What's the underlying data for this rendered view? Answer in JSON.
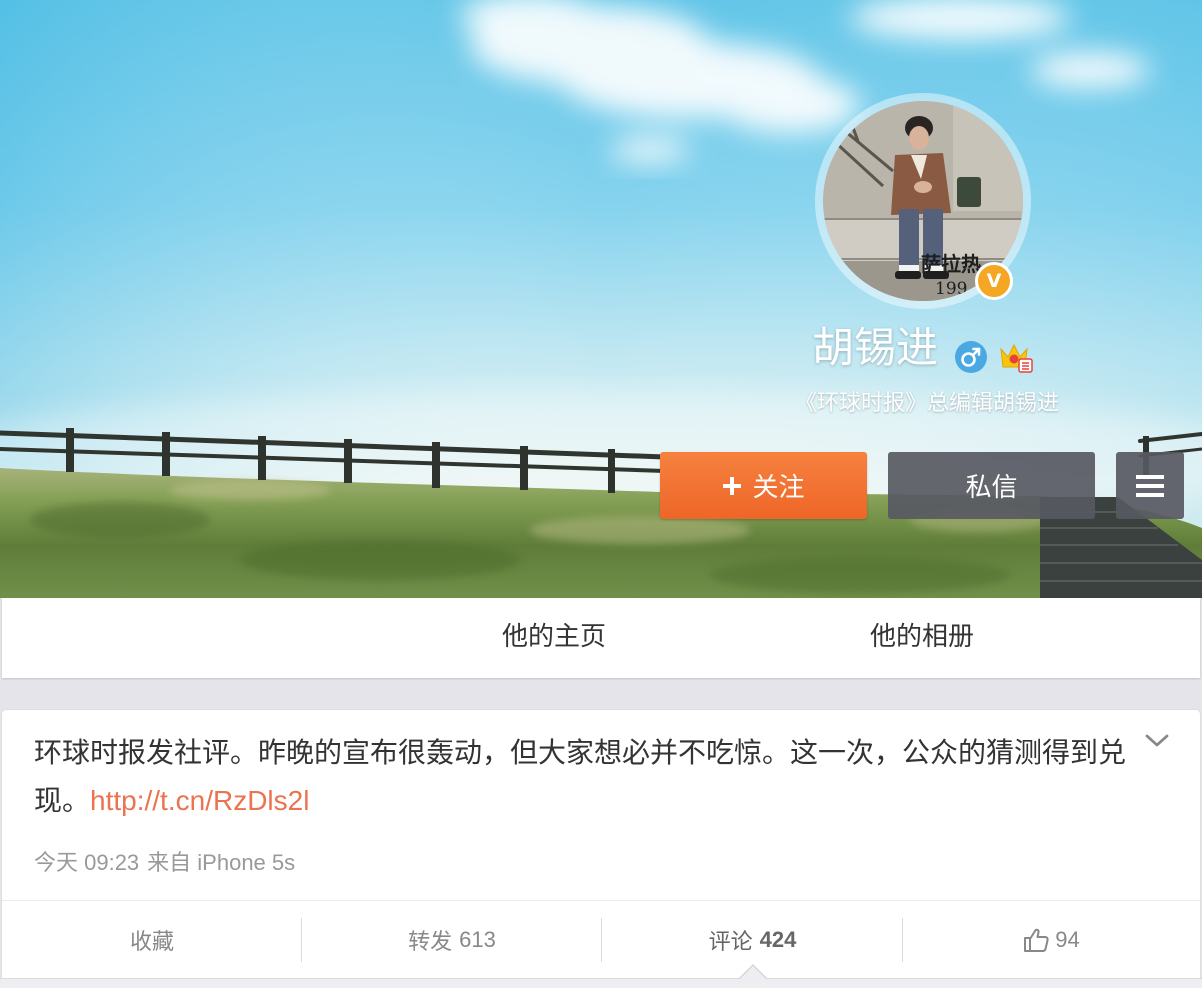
{
  "cover": {
    "image_icon": "landscape-cover"
  },
  "profile": {
    "avatar": {
      "caption_line1": "萨拉热",
      "caption_line2": "199"
    },
    "verified_badge": "V",
    "name": "胡锡进",
    "gender_icon": "male-icon",
    "member_icon": "crown-icon",
    "description": "《环球时报》总编辑胡锡进"
  },
  "actions": {
    "follow": {
      "icon": "plus-icon",
      "label": "关注"
    },
    "message": {
      "label": "私信"
    },
    "menu": {
      "icon": "menu-icon"
    }
  },
  "tabs": [
    {
      "label": "他的主页"
    },
    {
      "label": "他的相册"
    }
  ],
  "post": {
    "text": "环球时报发社评。昨晚的宣布很轰动，但大家想必并不吃惊。这一次，公众的猜测得到兑现。",
    "link": "http://t.cn/RzDls2l",
    "time": "今天 09:23",
    "source": "来自 iPhone 5s",
    "expand_icon": "chevron-down-icon"
  },
  "post_actions": {
    "favorite": {
      "label": "收藏"
    },
    "repost": {
      "label": "转发",
      "count": "613"
    },
    "comment": {
      "label": "评论",
      "count": "424"
    },
    "like": {
      "icon": "thumbs-up-icon",
      "count": "94"
    }
  },
  "colors": {
    "follow_button": "#f06b2c",
    "secondary_button": "#585962",
    "link": "#eb7350",
    "verified_badge": "#f5a623",
    "gender_icon": "#4aa9e3"
  }
}
